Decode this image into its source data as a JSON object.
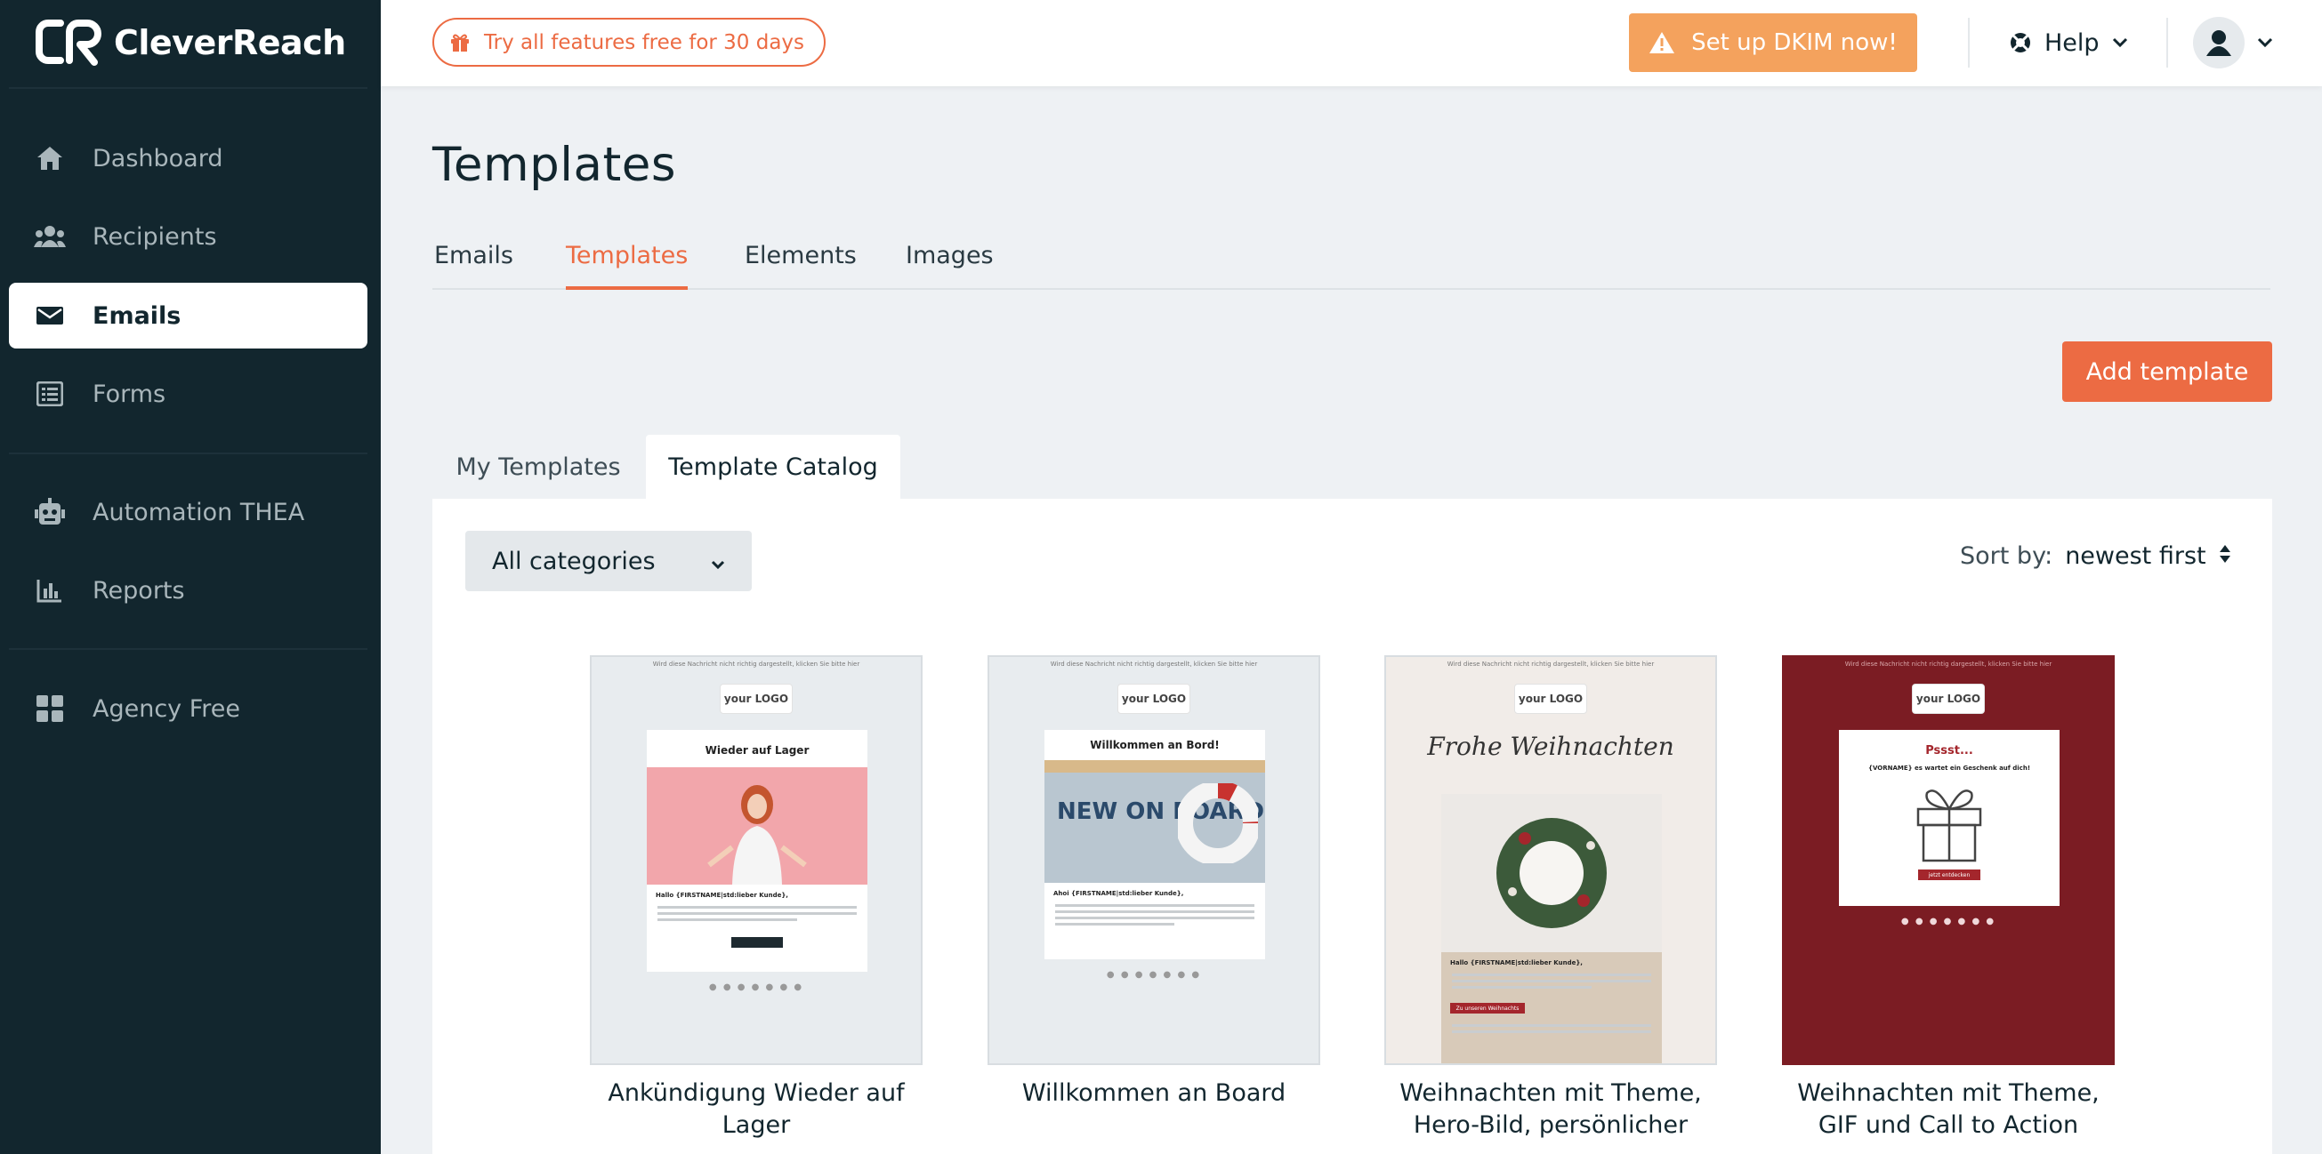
{
  "brand": {
    "name": "CleverReach",
    "accent": "#ec6b43",
    "sidebar_bg": "#12262e"
  },
  "sidebar": {
    "items": [
      {
        "label": "Dashboard",
        "icon": "home-icon"
      },
      {
        "label": "Recipients",
        "icon": "users-icon"
      },
      {
        "label": "Emails",
        "icon": "envelope-icon",
        "active": true
      },
      {
        "label": "Forms",
        "icon": "form-list-icon"
      },
      {
        "label": "Automation THEA",
        "icon": "robot-icon"
      },
      {
        "label": "Reports",
        "icon": "bar-chart-icon"
      },
      {
        "label": "Agency Free",
        "icon": "grid-icon"
      }
    ]
  },
  "topbar": {
    "trial_label": "Try all features free for 30 days",
    "dkim_label": "Set up DKIM now!",
    "help_label": "Help"
  },
  "main": {
    "title": "Templates",
    "tabs": [
      {
        "label": "Emails"
      },
      {
        "label": "Templates",
        "active": true
      },
      {
        "label": "Elements"
      },
      {
        "label": "Images"
      }
    ],
    "add_button": "Add template",
    "subtabs": [
      {
        "label": "My Templates"
      },
      {
        "label": "Template Catalog",
        "active": true
      }
    ],
    "category_select": "All categories",
    "sort_label": "Sort by:",
    "sort_value": "newest first",
    "templates": [
      {
        "title": "Ankündigung Wieder auf Lager",
        "heading": "Wieder auf Lager",
        "greeting": "Hallo {FIRSTNAME|std:lieber Kunde},",
        "button": "jetzt kaufen"
      },
      {
        "title": "Willkommen an Board",
        "heading": "Willkommen an Bord!",
        "image_text": "NEW ON BOARD",
        "greeting": "Ahoi {FIRSTNAME|std:lieber Kunde},",
        "button": ""
      },
      {
        "title": "Weihnachten mit Theme, Hero-Bild, persönlicher",
        "heading": "Frohe Weihnachten",
        "greeting": "Hallo {FIRSTNAME|std:lieber Kunde},",
        "button": "Zu unseren Weihnachts"
      },
      {
        "title": "Weihnachten mit Theme, GIF und Call to Action",
        "heading": "Pssst...",
        "subheading": "{VORNAME} es wartet ein Geschenk auf dich!",
        "button": "jetzt entdecken"
      }
    ],
    "thumb_topline": "Wird diese Nachricht nicht richtig dargestellt, klicken Sie bitte hier",
    "thumb_logo": "your LOGO"
  }
}
